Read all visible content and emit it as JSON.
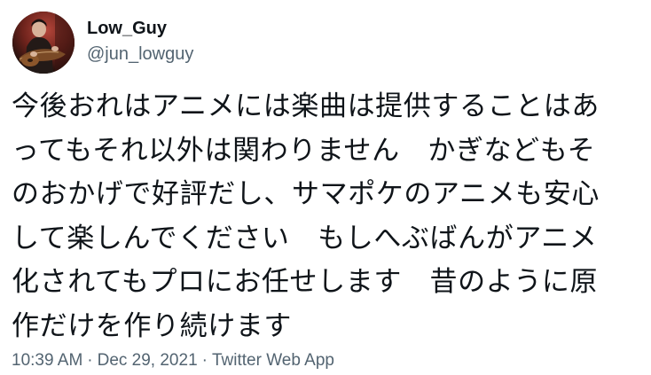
{
  "author": {
    "display_name": "Low_Guy",
    "handle": "@jun_lowguy"
  },
  "tweet": {
    "lines": [
      "今後おれはアニメには楽曲は提供することはあ",
      "ってもそれ以外は関わりません　かぎなどもそ",
      "のおかげで好評だし、サマポケのアニメも安心",
      "して楽しんでください　もしへぶばんがアニメ",
      "化されてもプロにお任せします　昔のように原",
      "作だけを作り続けます"
    ]
  },
  "meta": {
    "time": "10:39 AM",
    "separator": "·",
    "date": "Dec 29, 2021",
    "source": "Twitter Web App"
  }
}
